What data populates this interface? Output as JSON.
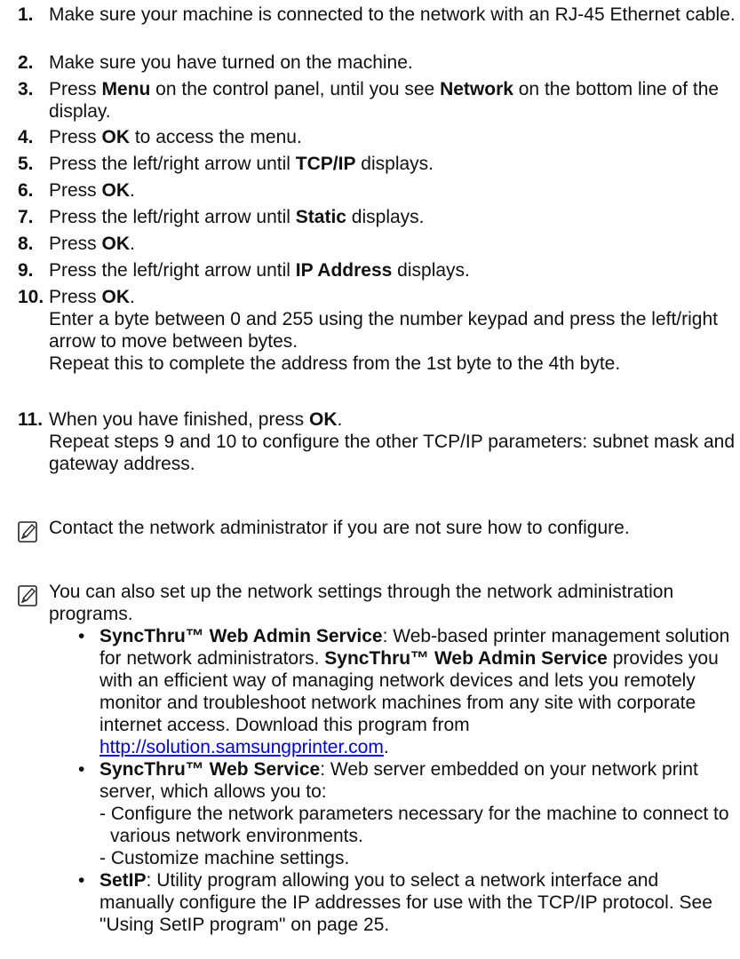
{
  "steps": [
    {
      "num": "1.",
      "parts": [
        {
          "t": "Make sure your machine is connected to the network with an RJ-45 Ethernet cable.",
          "b": false
        }
      ]
    },
    {
      "num": "2.",
      "parts": [
        {
          "t": "Make sure you have turned on the machine.",
          "b": false
        }
      ]
    },
    {
      "num": "3.",
      "parts": [
        {
          "t": "Press ",
          "b": false
        },
        {
          "t": "Menu",
          "b": true
        },
        {
          "t": " on the control panel, until you see ",
          "b": false
        },
        {
          "t": "Network",
          "b": true
        },
        {
          "t": " on the bottom line of the display.",
          "b": false
        }
      ]
    },
    {
      "num": "4.",
      "parts": [
        {
          "t": "Press ",
          "b": false
        },
        {
          "t": "OK",
          "b": true
        },
        {
          "t": " to access the menu.",
          "b": false
        }
      ]
    },
    {
      "num": "5.",
      "parts": [
        {
          "t": "Press the left/right arrow until ",
          "b": false
        },
        {
          "t": "TCP/IP",
          "b": true
        },
        {
          "t": " displays.",
          "b": false
        }
      ]
    },
    {
      "num": "6.",
      "parts": [
        {
          "t": "Press ",
          "b": false
        },
        {
          "t": "OK",
          "b": true
        },
        {
          "t": ".",
          "b": false
        }
      ]
    },
    {
      "num": "7.",
      "parts": [
        {
          "t": "Press the left/right arrow until ",
          "b": false
        },
        {
          "t": "Static",
          "b": true
        },
        {
          "t": " displays.",
          "b": false
        }
      ]
    },
    {
      "num": "8.",
      "parts": [
        {
          "t": "Press ",
          "b": false
        },
        {
          "t": "OK",
          "b": true
        },
        {
          "t": ".",
          "b": false
        }
      ]
    },
    {
      "num": "9.",
      "parts": [
        {
          "t": "Press the left/right arrow until ",
          "b": false
        },
        {
          "t": "IP Address",
          "b": true
        },
        {
          "t": " displays.",
          "b": false
        }
      ]
    },
    {
      "num": "10.",
      "parts": [
        {
          "t": "Press ",
          "b": false
        },
        {
          "t": "OK",
          "b": true
        },
        {
          "t": ".",
          "b": false
        }
      ],
      "sub": [
        "Enter a byte between 0 and 255 using the number keypad and press the left/right arrow  to move between bytes.",
        "Repeat this to complete the address from the 1st byte to the 4th byte."
      ]
    },
    {
      "num": "11.",
      "parts": [
        {
          "t": "When you have finished, press ",
          "b": false
        },
        {
          "t": "OK",
          "b": true
        },
        {
          "t": ".",
          "b": false
        }
      ],
      "sub": [
        "Repeat steps 9 and 10 to configure the other TCP/IP parameters: subnet mask and gateway address."
      ]
    }
  ],
  "note1": {
    "icon": "note-pencil-icon",
    "text": "Contact the network administrator if you are not sure how to configure."
  },
  "note2": {
    "icon": "note-pencil-icon",
    "intro": "You can also set up the network settings through the network administration programs.",
    "bullets": [
      {
        "mark": "•",
        "parts": [
          {
            "t": "SyncThru™ Web Admin Service",
            "b": true
          },
          {
            "t": ": Web-based printer management solution for network administrators. ",
            "b": false
          },
          {
            "t": "SyncThru™ Web Admin Service",
            "b": true
          },
          {
            "t": " provides you with an efficient way of managing network devices and lets you remotely monitor and troubleshoot network machines from any site with corporate internet access. Download this program from ",
            "b": false
          },
          {
            "t": "http://solution.samsungprinter.com",
            "b": false,
            "link": true
          },
          {
            "t": ".",
            "b": false
          }
        ]
      },
      {
        "mark": "•",
        "parts": [
          {
            "t": "SyncThru™ Web Service",
            "b": true
          },
          {
            "t": ": Web server embedded on your network print server, which allows you to:",
            "b": false
          }
        ],
        "dashes": [
          "- Configure the network parameters necessary for the machine to connect to various network environments.",
          "- Customize machine settings."
        ]
      },
      {
        "mark": "•",
        "parts": [
          {
            "t": "SetIP",
            "b": true
          },
          {
            "t": ": Utility program allowing you to select a network interface and manually configure the IP addresses for use with the TCP/IP protocol. See \"Using SetIP program\" on page 25.",
            "b": false
          }
        ]
      }
    ]
  }
}
